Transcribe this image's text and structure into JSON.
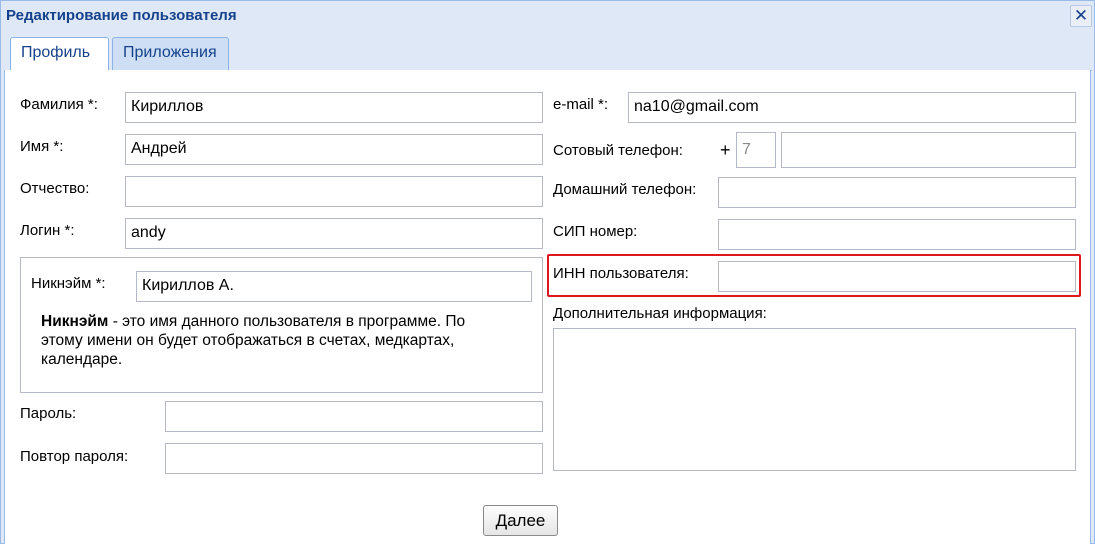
{
  "window": {
    "title": "Редактирование пользователя",
    "close_symbol": "✕"
  },
  "tabs": [
    {
      "label": "Профиль",
      "active": true
    },
    {
      "label": "Приложения",
      "active": false
    }
  ],
  "form": {
    "last_name": {
      "label": "Фамилия *:",
      "value": "Кириллов"
    },
    "first_name": {
      "label": "Имя *:",
      "value": "Андрей"
    },
    "middle_name": {
      "label": "Отчество:",
      "value": ""
    },
    "login": {
      "label": "Логин *:",
      "value": "andy"
    },
    "nickname": {
      "label": "Никнэйм *:",
      "value": "Кириллов А.",
      "help_bold": "Никнэйм",
      "help_text": " - это имя данного пользователя в программе. По этому имени он будет отображаться в счетах, медкартах, календаре."
    },
    "password": {
      "label": "Пароль:",
      "value": ""
    },
    "password_repeat": {
      "label": "Повтор пароля:",
      "value": ""
    },
    "email": {
      "label": "e-mail *:",
      "value": "na10@gmail.com"
    },
    "mobile": {
      "label": "Сотовый телефон:",
      "plus": "+",
      "country_code": "7",
      "number": ""
    },
    "home_phone": {
      "label": "Домашний телефон:",
      "value": ""
    },
    "sip": {
      "label": "СИП номер:",
      "value": ""
    },
    "inn": {
      "label": "ИНН пользователя:",
      "value": ""
    },
    "extra_info": {
      "label": "Дополнительная информация:",
      "value": ""
    }
  },
  "buttons": {
    "next": "Далее"
  },
  "colors": {
    "title_text": "#15428b",
    "frame_bg": "#dfe8f6",
    "highlight": "#e0161e"
  }
}
